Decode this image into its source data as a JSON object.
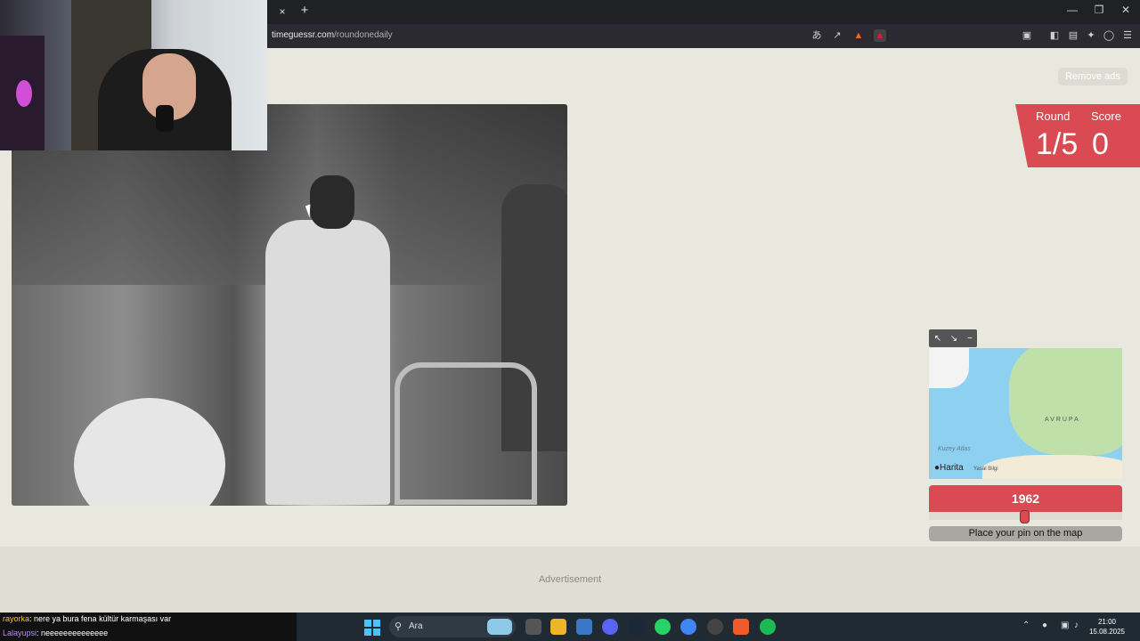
{
  "browser": {
    "url_domain": "timeguessr.com",
    "url_path": "/roundonedaily",
    "tab_close_label": "×",
    "tab_new_label": "+"
  },
  "header": {
    "remove_ads_label": "Remove ads"
  },
  "score": {
    "round_label": "Round",
    "round_value": "1/5",
    "score_label": "Score",
    "score_value": "0"
  },
  "map": {
    "region_label": "AVRUPA",
    "ocean_label": "Kuzey Atlas",
    "brand_label": "Harita",
    "legal_label": "Yasal Bilgi"
  },
  "year": {
    "value": "1962",
    "slider_fraction": 0.5
  },
  "actions": {
    "place_pin_label": "Place your pin on the map"
  },
  "ad": {
    "label": "Advertisement"
  },
  "chat": {
    "messages": [
      {
        "user": "rayorka",
        "text": ": nere ya bura fena kültür karmaşası var"
      },
      {
        "user": "Lalayupsi",
        "text": ": neeeeeeeeeeeeee"
      }
    ]
  },
  "taskbar": {
    "search_placeholder": "Ara",
    "time": "21:00",
    "date": "15.08.2025"
  },
  "colors": {
    "accent": "#d94a53",
    "page_bg": "#e9e8de"
  }
}
